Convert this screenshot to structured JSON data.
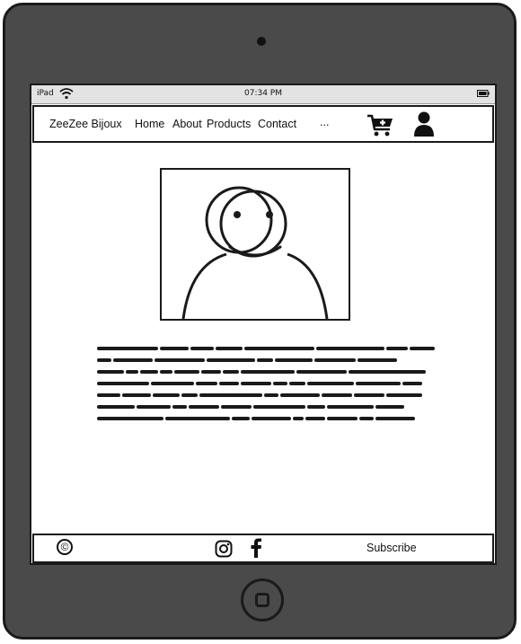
{
  "status_bar": {
    "device": "iPad",
    "time": "07:34 PM"
  },
  "navbar": {
    "brand": "ZeeZee Bijoux",
    "links": [
      "Home",
      "About",
      "Products",
      "Contact"
    ],
    "overflow": "...",
    "icons": [
      "cart-plus-icon",
      "user-icon"
    ]
  },
  "main": {
    "image_icon": "avatar-placeholder-icon",
    "text_block": "scribbled placeholder text"
  },
  "footer": {
    "copyright_symbol": "©",
    "icons": [
      "instagram-icon",
      "facebook-icon"
    ],
    "subscribe_label": "Subscribe"
  },
  "colors": {
    "device": "#4a4a4a",
    "stroke": "#1a1a1a",
    "status_bar": "#e3e3e3"
  }
}
